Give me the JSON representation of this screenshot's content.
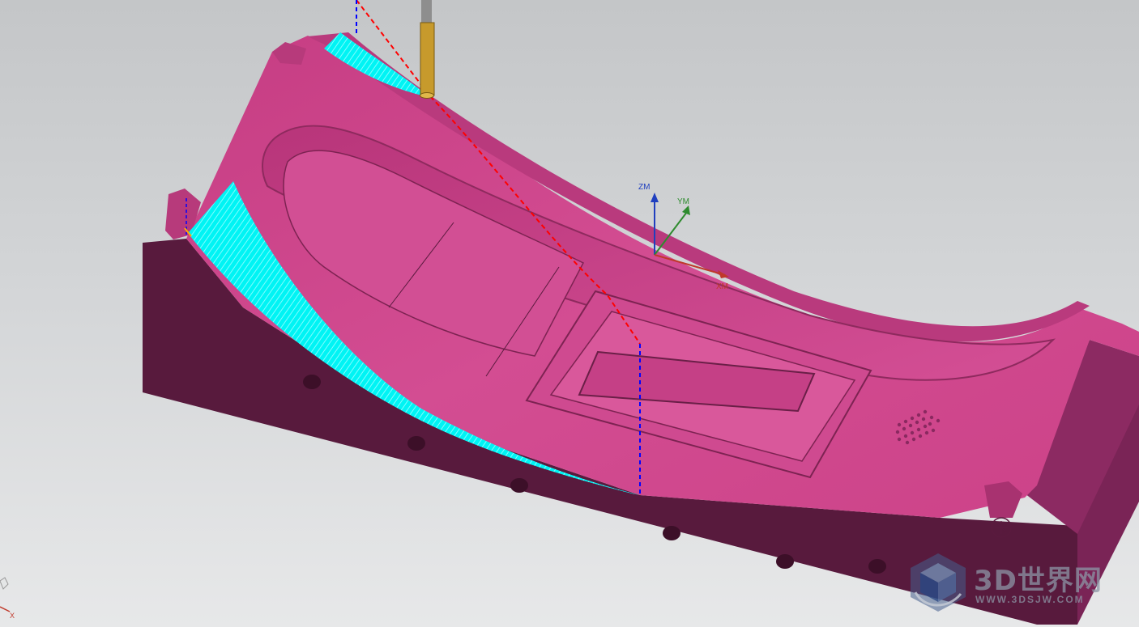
{
  "viewport": {
    "background_top": "#c4c6c8",
    "background_bottom": "#e7e8e9"
  },
  "colors": {
    "part_top": "#d0468c",
    "part_side": "#5a1a3e",
    "part_side_right": "#7a2456",
    "toolpath": "#00ffff",
    "tool_shank": "#c79a2c",
    "rapid_move": "#ff0000",
    "engage_move": "#0000ff",
    "axis_z": "#1f3fbf",
    "axis_y": "#2e8b2e",
    "axis_x": "#c0392b"
  },
  "wcs": {
    "z_label": "ZM",
    "y_label": "YM",
    "x_label": "XM"
  },
  "triad": {
    "x_label": "X"
  },
  "watermark": {
    "title": "3D世界网",
    "url": "WWW.3DSJW.COM",
    "icon": "cube-logo-icon"
  }
}
